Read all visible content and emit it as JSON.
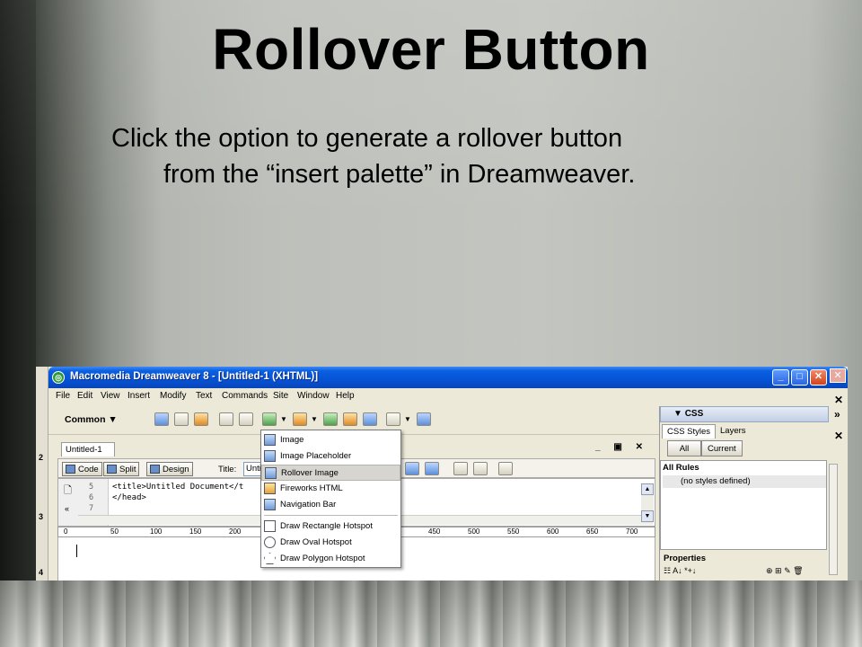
{
  "slide": {
    "title": "Rollover Button",
    "body_line1": "Click the option to generate a rollover button",
    "body_line2": "from the “insert palette” in Dreamweaver."
  },
  "app": {
    "window_title": "Macromedia Dreamweaver 8 - [Untitled-1 (XHTML)]",
    "menu": [
      "File",
      "Edit",
      "View",
      "Insert",
      "Modify",
      "Text",
      "Commands",
      "Site",
      "Window",
      "Help"
    ],
    "insert_bar_category": "Common",
    "left_ruler_numbers": [
      "2",
      "3",
      "4"
    ]
  },
  "document": {
    "tab": "Untitled-1",
    "view_buttons": [
      "Code",
      "Split",
      "Design"
    ],
    "title_label": "Title:",
    "title_value": "Untitled",
    "line_numbers": [
      "5",
      "6",
      "7"
    ],
    "code_lines": [
      "<title>Untitled Document</t",
      "</head>"
    ],
    "ruler_ticks": [
      "0",
      "50",
      "100",
      "150",
      "200",
      "450",
      "500",
      "550",
      "600",
      "650",
      "700"
    ]
  },
  "insert_menu": {
    "items": [
      {
        "label": "Image",
        "selected": false
      },
      {
        "label": "Image Placeholder",
        "selected": false
      },
      {
        "label": "Rollover Image",
        "selected": true
      },
      {
        "label": "Fireworks HTML",
        "selected": false
      },
      {
        "label": "Navigation Bar",
        "selected": false
      },
      {
        "label": "Draw Rectangle Hotspot",
        "selected": false
      },
      {
        "label": "Draw Oval Hotspot",
        "selected": false
      },
      {
        "label": "Draw Polygon Hotspot",
        "selected": false
      }
    ]
  },
  "css_panel": {
    "header": "CSS",
    "tabs": [
      "CSS Styles",
      "Layers"
    ],
    "buttons": [
      "All",
      "Current"
    ],
    "list_header": "All Rules",
    "list_row": "(no styles defined)",
    "properties_label": "Properties"
  },
  "colors": {
    "xp_title_blue": "#0653d6",
    "menu_selected": "#d7d5cf",
    "panel_bg": "#ece9d8"
  }
}
